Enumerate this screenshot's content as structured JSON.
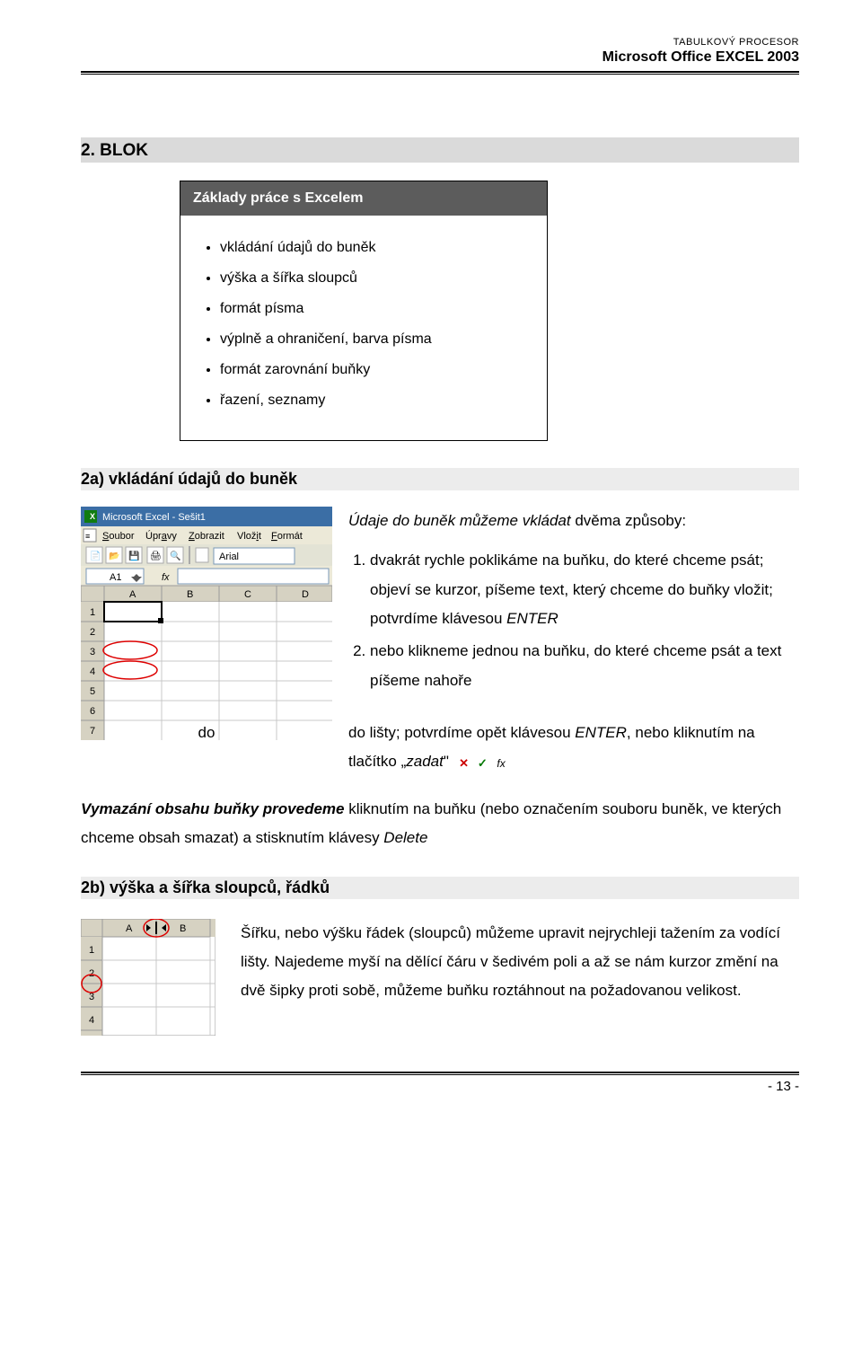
{
  "header": {
    "line1": "TABULKOVÝ PROCESOR",
    "line2": "Microsoft Office EXCEL 2003"
  },
  "section_title": "2. BLOK",
  "box": {
    "title": "Základy práce s Excelem",
    "items": [
      "vkládání údajů do buněk",
      "výška a šířka sloupců",
      "formát písma",
      "výplně a ohraničení, barva písma",
      "formát zarovnání buňky",
      "řazení, seznamy"
    ]
  },
  "sub2a": "2a) vkládání údajů do buněk",
  "para2a_intro_pre": "Údaje do buněk můžeme vkládat",
  "para2a_intro_post": " dvěma způsoby:",
  "ol": [
    {
      "pre": "dvakrát rychle poklikáme na buňku, do které chceme psát; objeví se kurzor, píšeme text, který chceme do buňky vložit; potvrdíme klávesou ",
      "em": "ENTER"
    },
    {
      "pre": "nebo klikneme jednou na buňku, do které chceme psát a text píšeme nahoře"
    }
  ],
  "below_do_left": "do",
  "below_do_text_pre": "do lišty; potvrdíme opět klávesou ",
  "below_do_enter": "ENTER",
  "below_do_text_mid": ", nebo kliknutím na tlačítko „",
  "below_do_zadat": "zadat",
  "below_do_text_post": "\"",
  "vymazani_bold": "Vymazání obsahu buňky provedeme",
  "vymazani_rest": " kliknutím na buňku (nebo označením souboru buněk, ve kterých chceme obsah smazat) a stisknutím klávesy ",
  "vymazani_delete": "Delete",
  "sub2b": "2b) výška a šířka sloupců, řádků",
  "para2b": "Šířku, nebo výšku řádek (sloupců) můžeme upravit nejrychleji tažením za vodící lišty. Najedeme myší na dělící čáru v šedivém poli a až se nám kurzor změní na dvě šipky proti sobě, můžeme buňku roztáhnout na požadovanou velikost.",
  "page_number": "- 13 -",
  "excel_window": {
    "title_prefix": "Microsoft Excel - ",
    "title_doc": "Sešit1",
    "menus": [
      "Soubor",
      "Úpravy",
      "Zobrazit",
      "Vložit",
      "Formát"
    ],
    "font_name": "Arial",
    "cell_ref": "A1",
    "columns": [
      "A",
      "B",
      "C",
      "D"
    ],
    "rows": [
      "1",
      "2",
      "3",
      "4",
      "5",
      "6",
      "7"
    ]
  },
  "headers_shot": {
    "cols": [
      "A",
      "B"
    ],
    "rows": [
      "1",
      "2",
      "3",
      "4"
    ]
  }
}
